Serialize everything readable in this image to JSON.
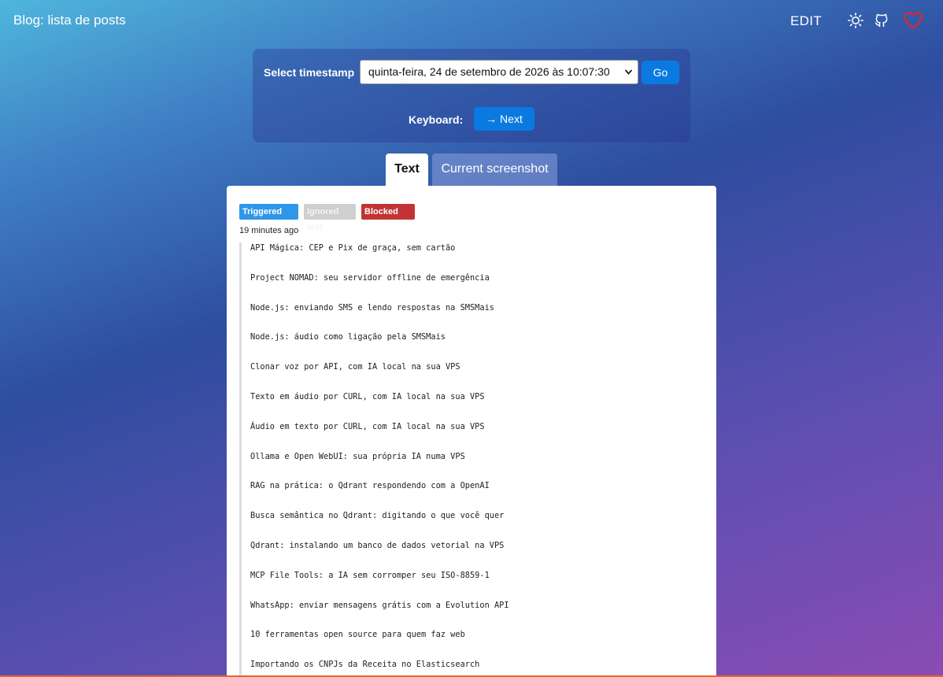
{
  "header": {
    "site_title": "Blog: lista de posts",
    "edit_label": "EDIT",
    "icons": [
      "sun-icon",
      "github-icon",
      "heart-icon"
    ]
  },
  "timestamp_panel": {
    "label": "Select timestamp",
    "selected_value": "quinta-feira, 24 de setembro de 2026 às 10:07:30",
    "go_label": "Go",
    "keyboard_label": "Keyboard:",
    "next_label": "→ Next"
  },
  "tabs": [
    {
      "label": "Text",
      "active": true
    },
    {
      "label": "Current screenshot",
      "active": false
    }
  ],
  "badges": {
    "triggered": "Triggered text",
    "ignored": "Ignored text",
    "blocked": "Blocked text"
  },
  "time_ago": "19 minutes ago",
  "lines": [
    "API Mágica: CEP e Pix de graça, sem cartão",
    "Project NOMAD: seu servidor offline de emergência",
    "Node.js: enviando SMS e lendo respostas na SMSMais",
    "Node.js: áudio como ligação pela SMSMais",
    "Clonar voz por API, com IA local na sua VPS",
    "Texto em áudio por CURL, com IA local na sua VPS",
    "Áudio em texto por CURL, com IA local na sua VPS",
    "Ollama e Open WebUI: sua própria IA numa VPS",
    "RAG na prática: o Qdrant respondendo com a OpenAI",
    "Busca semântica no Qdrant: digitando o que você quer",
    "Qdrant: instalando um banco de dados vetorial na VPS",
    "MCP File Tools: a IA sem corromper seu ISO-8859-1",
    "WhatsApp: enviar mensagens grátis com a Evolution API",
    "10 ferramentas open source para quem faz web",
    "Importando os CNPJs da Receita no Elasticsearch"
  ],
  "colors": {
    "accent_blue": "#0a7ae0",
    "triggered": "#2f96e8",
    "ignored": "#cfcfcf",
    "blocked": "#c23434",
    "heart": "#e0262b"
  }
}
